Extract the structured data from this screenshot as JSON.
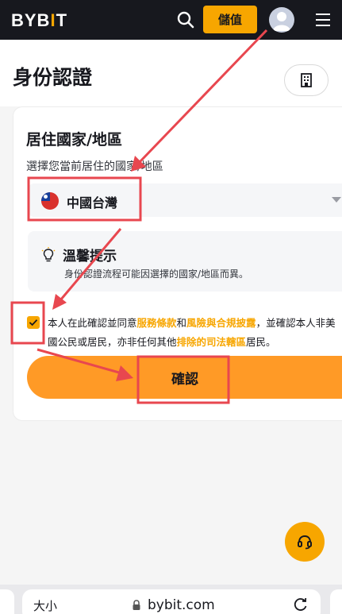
{
  "topbar": {
    "logo": "BYBIT",
    "deposit_label": "儲值"
  },
  "header": {
    "title": "身份認證"
  },
  "form": {
    "section_title": "居住國家/地區",
    "section_subtitle": "選擇您當前居住的國家/地區",
    "selected_country": "中國台灣",
    "tip_title": "溫馨提示",
    "tip_text": "身份認證流程可能因選擇的國家/地區而異。",
    "consent_checked": true,
    "consent_part1": "本人在此確認並同意",
    "consent_link1": "服務條款",
    "consent_part2": "和",
    "consent_link2": "風險與合規披露",
    "consent_part3": "，並確認本人非美國公民或居民，亦非任何其他",
    "consent_link3": "排除的司法轄區",
    "consent_part4": "居民。",
    "confirm_label": "確認"
  },
  "browser": {
    "left_label": "大小",
    "url": "bybit.com"
  },
  "colors": {
    "brand": "#f7a600",
    "topbar_bg": "#17181e",
    "annotation": "#e8474f"
  },
  "icons": {
    "search": "search-icon",
    "menu": "hamburger-menu-icon",
    "building": "building-icon",
    "bulb": "lightbulb-icon",
    "support": "headset-icon",
    "lock": "lock-icon",
    "reload": "reload-icon"
  }
}
